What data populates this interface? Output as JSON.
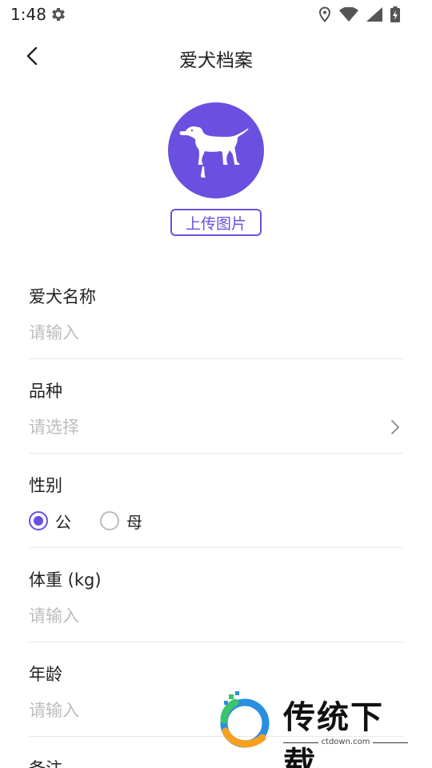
{
  "status_bar": {
    "time": "1:48",
    "icons": [
      "gear-icon",
      "location-icon",
      "wifi-icon",
      "signal-icon",
      "battery-charging-icon"
    ]
  },
  "header": {
    "back_icon": "chevron-left-icon",
    "title": "爱犬档案"
  },
  "avatar": {
    "icon": "dog-icon",
    "background": "#6a4fe0"
  },
  "upload_button": {
    "label": "上传图片"
  },
  "form": {
    "name": {
      "label": "爱犬名称",
      "placeholder": "请输入"
    },
    "breed": {
      "label": "品种",
      "placeholder": "请选择"
    },
    "gender": {
      "label": "性别",
      "options": [
        "公",
        "母"
      ],
      "selected": "公"
    },
    "weight": {
      "label": "体重 (kg)",
      "placeholder": "请输入"
    },
    "age": {
      "label": "年龄",
      "placeholder": "请输入"
    },
    "notes": {
      "label": "备注"
    }
  },
  "watermark": {
    "brand": "传统下载",
    "url": "ctdown.com"
  },
  "colors": {
    "accent": "#6a4fe0",
    "placeholder": "#bdbdbd",
    "divider": "#e8e8e8"
  }
}
